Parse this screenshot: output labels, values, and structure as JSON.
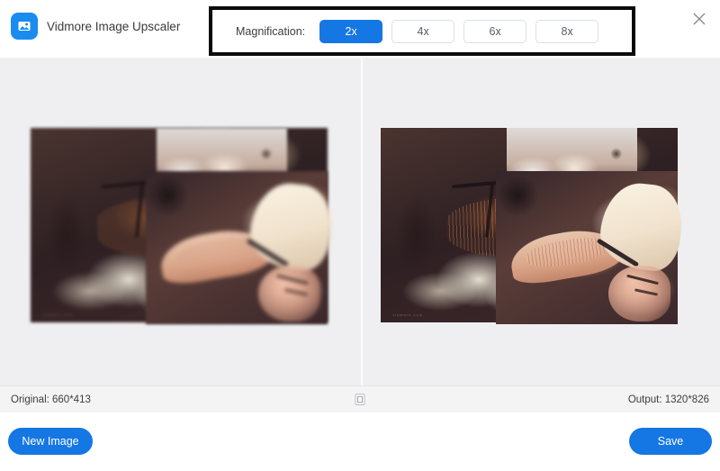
{
  "app": {
    "title": "Vidmore Image Upscaler",
    "logo_icon": "image-photo-icon",
    "accent_color": "#1577e3",
    "panel_background": "#efeff1",
    "annotation_color": "#0b0b0b"
  },
  "header": {
    "close_icon": "close-icon",
    "magnification": {
      "label": "Magnification:",
      "selected": "2x",
      "options": [
        {
          "label": "2x",
          "active": true
        },
        {
          "label": "4x",
          "active": false
        },
        {
          "label": "6x",
          "active": false
        },
        {
          "label": "8x",
          "active": false
        }
      ]
    }
  },
  "preview": {
    "original_pane_name": "original-image-preview",
    "upscaled_pane_name": "upscaled-image-preview",
    "image_watermark": "vidmore.com",
    "divider_name": "preview-divider"
  },
  "statusbar": {
    "original": "Original: 660*413",
    "output": "Output: 1320*826",
    "handle_icon": "compare-slider-handle-icon"
  },
  "footer": {
    "new_image_label": "New Image",
    "save_label": "Save"
  }
}
